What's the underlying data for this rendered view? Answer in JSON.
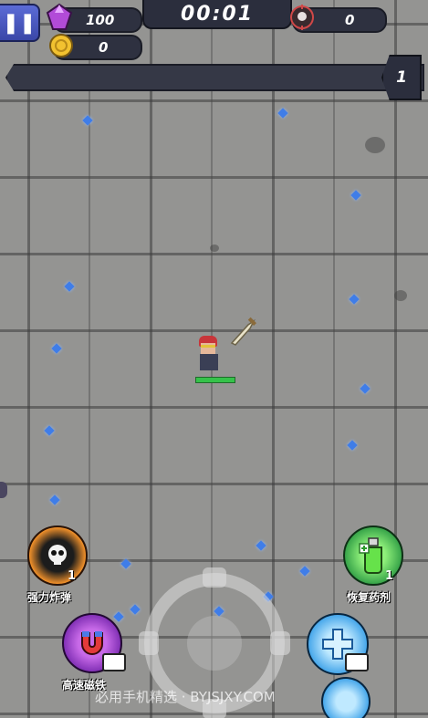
{
  "hud": {
    "gems": "100",
    "coins": "0",
    "timer": "00:01",
    "kills": "0",
    "level": "1",
    "xp_progress": 0
  },
  "skills": {
    "bomb": {
      "label": "强力炸弹",
      "count": "1"
    },
    "potion": {
      "label": "恢复药剂",
      "count": "1"
    },
    "magnet": {
      "label": "高速磁铁"
    },
    "shield": {
      "label": ""
    }
  },
  "watermark": "必用手机精选 · BYJSJXY.COM",
  "colors": {
    "gem": "#3f7de8",
    "hp": "#35c24a",
    "hud_dark": "#2e3140",
    "pause": "#4a58c4"
  },
  "icons": {
    "pause": "pause-icon",
    "gem": "gem-icon",
    "coin": "coin-icon",
    "skull": "skull-target-icon",
    "video": "video-ad-icon"
  }
}
